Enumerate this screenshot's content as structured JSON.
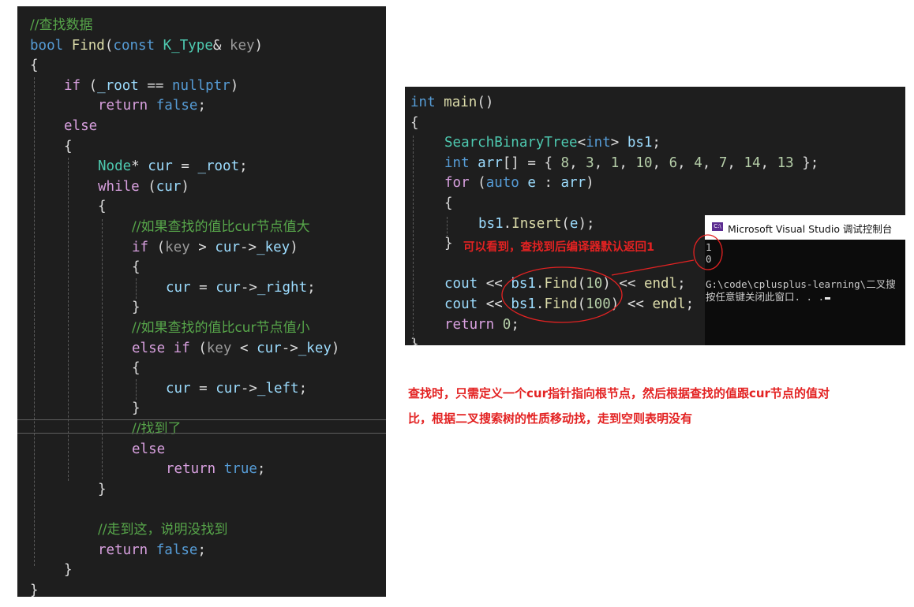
{
  "left_editor": {
    "lines": [
      {
        "indent": 0,
        "tokens": [
          [
            "cm",
            "//查找数据"
          ]
        ]
      },
      {
        "indent": 0,
        "tokens": [
          [
            "kw",
            "bool"
          ],
          [
            "pn",
            " "
          ],
          [
            "fn",
            "Find"
          ],
          [
            "pn",
            "("
          ],
          [
            "kw",
            "const"
          ],
          [
            "pn",
            " "
          ],
          [
            "ty",
            "K_Type"
          ],
          [
            "pn",
            "& "
          ],
          [
            "prm",
            "key"
          ],
          [
            "pn",
            ")"
          ]
        ]
      },
      {
        "indent": 0,
        "tokens": [
          [
            "pn",
            "{"
          ]
        ]
      },
      {
        "indent": 1,
        "tokens": [
          [
            "ctl",
            "if"
          ],
          [
            "pn",
            " ("
          ],
          [
            "var",
            "_root"
          ],
          [
            "pn",
            " == "
          ],
          [
            "kw",
            "nullptr"
          ],
          [
            "pn",
            ")"
          ]
        ]
      },
      {
        "indent": 2,
        "tokens": [
          [
            "ctl",
            "return"
          ],
          [
            "pn",
            " "
          ],
          [
            "kw",
            "false"
          ],
          [
            "pn",
            ";"
          ]
        ]
      },
      {
        "indent": 1,
        "tokens": [
          [
            "ctl",
            "else"
          ]
        ]
      },
      {
        "indent": 1,
        "tokens": [
          [
            "pn",
            "{"
          ]
        ]
      },
      {
        "indent": 2,
        "tokens": [
          [
            "ty",
            "Node"
          ],
          [
            "pn",
            "* "
          ],
          [
            "var",
            "cur"
          ],
          [
            "pn",
            " = "
          ],
          [
            "var",
            "_root"
          ],
          [
            "pn",
            ";"
          ]
        ]
      },
      {
        "indent": 2,
        "tokens": [
          [
            "ctl",
            "while"
          ],
          [
            "pn",
            " ("
          ],
          [
            "var",
            "cur"
          ],
          [
            "pn",
            ")"
          ]
        ]
      },
      {
        "indent": 2,
        "tokens": [
          [
            "pn",
            "{"
          ]
        ]
      },
      {
        "indent": 3,
        "tokens": [
          [
            "cm",
            "//如果查找的值比cur节点值大"
          ]
        ]
      },
      {
        "indent": 3,
        "tokens": [
          [
            "ctl",
            "if"
          ],
          [
            "pn",
            " ("
          ],
          [
            "prm",
            "key"
          ],
          [
            "pn",
            " > "
          ],
          [
            "var",
            "cur"
          ],
          [
            "pn",
            "->"
          ],
          [
            "var",
            "_key"
          ],
          [
            "pn",
            ")"
          ]
        ]
      },
      {
        "indent": 3,
        "tokens": [
          [
            "pn",
            "{"
          ]
        ]
      },
      {
        "indent": 4,
        "tokens": [
          [
            "var",
            "cur"
          ],
          [
            "pn",
            " = "
          ],
          [
            "var",
            "cur"
          ],
          [
            "pn",
            "->"
          ],
          [
            "var",
            "_right"
          ],
          [
            "pn",
            ";"
          ]
        ]
      },
      {
        "indent": 3,
        "tokens": [
          [
            "pn",
            "}"
          ]
        ]
      },
      {
        "indent": 3,
        "tokens": [
          [
            "cm",
            "//如果查找的值比cur节点值小"
          ]
        ]
      },
      {
        "indent": 3,
        "tokens": [
          [
            "ctl",
            "else"
          ],
          [
            "pn",
            " "
          ],
          [
            "ctl",
            "if"
          ],
          [
            "pn",
            " ("
          ],
          [
            "prm",
            "key"
          ],
          [
            "pn",
            " < "
          ],
          [
            "var",
            "cur"
          ],
          [
            "pn",
            "->"
          ],
          [
            "var",
            "_key"
          ],
          [
            "pn",
            ")"
          ]
        ]
      },
      {
        "indent": 3,
        "tokens": [
          [
            "pn",
            "{"
          ]
        ]
      },
      {
        "indent": 4,
        "tokens": [
          [
            "var",
            "cur"
          ],
          [
            "pn",
            " = "
          ],
          [
            "var",
            "cur"
          ],
          [
            "pn",
            "->"
          ],
          [
            "var",
            "_left"
          ],
          [
            "pn",
            ";"
          ]
        ]
      },
      {
        "indent": 3,
        "tokens": [
          [
            "pn",
            "}"
          ]
        ]
      },
      {
        "indent": 3,
        "tokens": [
          [
            "cm",
            "//找到了"
          ]
        ]
      },
      {
        "indent": 3,
        "tokens": [
          [
            "ctl",
            "else"
          ]
        ]
      },
      {
        "indent": 4,
        "tokens": [
          [
            "ctl",
            "return"
          ],
          [
            "pn",
            " "
          ],
          [
            "kw",
            "true"
          ],
          [
            "pn",
            ";"
          ]
        ]
      },
      {
        "indent": 2,
        "tokens": [
          [
            "pn",
            "}"
          ]
        ]
      },
      {
        "indent": 0,
        "tokens": []
      },
      {
        "indent": 2,
        "tokens": [
          [
            "cm",
            "//走到这，说明没找到"
          ]
        ]
      },
      {
        "indent": 2,
        "tokens": [
          [
            "ctl",
            "return"
          ],
          [
            "pn",
            " "
          ],
          [
            "kw",
            "false"
          ],
          [
            "pn",
            ";"
          ]
        ]
      },
      {
        "indent": 1,
        "tokens": [
          [
            "pn",
            "}"
          ]
        ]
      },
      {
        "indent": 0,
        "tokens": [
          [
            "pn",
            "}"
          ]
        ]
      }
    ]
  },
  "right_editor": {
    "lines": [
      {
        "indent": 0,
        "tokens": [
          [
            "kw",
            "int"
          ],
          [
            "pn",
            " "
          ],
          [
            "fn",
            "main"
          ],
          [
            "pn",
            "()"
          ]
        ]
      },
      {
        "indent": 0,
        "tokens": [
          [
            "pn",
            "{"
          ]
        ]
      },
      {
        "indent": 1,
        "tokens": [
          [
            "ty",
            "SearchBinaryTree"
          ],
          [
            "pn",
            "<"
          ],
          [
            "kw",
            "int"
          ],
          [
            "pn",
            "> "
          ],
          [
            "var",
            "bs1"
          ],
          [
            "pn",
            ";"
          ]
        ]
      },
      {
        "indent": 1,
        "tokens": [
          [
            "kw",
            "int"
          ],
          [
            "pn",
            " "
          ],
          [
            "var",
            "arr"
          ],
          [
            "pn",
            "[] = { "
          ],
          [
            "num",
            "8"
          ],
          [
            "pn",
            ", "
          ],
          [
            "num",
            "3"
          ],
          [
            "pn",
            ", "
          ],
          [
            "num",
            "1"
          ],
          [
            "pn",
            ", "
          ],
          [
            "num",
            "10"
          ],
          [
            "pn",
            ", "
          ],
          [
            "num",
            "6"
          ],
          [
            "pn",
            ", "
          ],
          [
            "num",
            "4"
          ],
          [
            "pn",
            ", "
          ],
          [
            "num",
            "7"
          ],
          [
            "pn",
            ", "
          ],
          [
            "num",
            "14"
          ],
          [
            "pn",
            ", "
          ],
          [
            "num",
            "13"
          ],
          [
            "pn",
            " };"
          ]
        ]
      },
      {
        "indent": 1,
        "tokens": [
          [
            "ctl",
            "for"
          ],
          [
            "pn",
            " ("
          ],
          [
            "kw",
            "auto"
          ],
          [
            "pn",
            " "
          ],
          [
            "var",
            "e"
          ],
          [
            "pn",
            " : "
          ],
          [
            "var",
            "arr"
          ],
          [
            "pn",
            ")"
          ]
        ]
      },
      {
        "indent": 1,
        "tokens": [
          [
            "pn",
            "{"
          ]
        ]
      },
      {
        "indent": 2,
        "tokens": [
          [
            "var",
            "bs1"
          ],
          [
            "pn",
            "."
          ],
          [
            "fn",
            "Insert"
          ],
          [
            "pn",
            "("
          ],
          [
            "var",
            "e"
          ],
          [
            "pn",
            ");"
          ]
        ]
      },
      {
        "indent": 1,
        "tokens": [
          [
            "pn",
            "}"
          ]
        ]
      },
      {
        "indent": 0,
        "tokens": []
      },
      {
        "indent": 1,
        "tokens": [
          [
            "var",
            "cout"
          ],
          [
            "pn",
            " << "
          ],
          [
            "var",
            "bs1"
          ],
          [
            "pn",
            "."
          ],
          [
            "fn",
            "Find"
          ],
          [
            "pn",
            "("
          ],
          [
            "num",
            "10"
          ],
          [
            "pn",
            ") << "
          ],
          [
            "fn",
            "endl"
          ],
          [
            "pn",
            ";"
          ]
        ]
      },
      {
        "indent": 1,
        "tokens": [
          [
            "var",
            "cout"
          ],
          [
            "pn",
            " << "
          ],
          [
            "var",
            "bs1"
          ],
          [
            "pn",
            "."
          ],
          [
            "fn",
            "Find"
          ],
          [
            "pn",
            "("
          ],
          [
            "num",
            "100"
          ],
          [
            "pn",
            ") << "
          ],
          [
            "fn",
            "endl"
          ],
          [
            "pn",
            ";"
          ]
        ]
      },
      {
        "indent": 1,
        "tokens": [
          [
            "ctl",
            "return"
          ],
          [
            "pn",
            " "
          ],
          [
            "num",
            "0"
          ],
          [
            "pn",
            ";"
          ]
        ]
      },
      {
        "indent": 0,
        "tokens": [
          [
            "pn",
            "}"
          ]
        ]
      }
    ]
  },
  "console": {
    "title": "Microsoft Visual Studio 调试控制台",
    "icon": "vs-console-icon",
    "output_lines": [
      "1",
      "0",
      "",
      "G:\\code\\cplusplus-learning\\二叉搜",
      "按任意键关闭此窗口. . ."
    ]
  },
  "annotations": {
    "return_note": "可以看到，查找到后编译器默认返回1",
    "description_line1": "查找时，只需定义一个cur指针指向根节点，然后根据查找的值跟cur节点的值对",
    "description_line2": "比，根据二叉搜索树的性质移动找，走到空则表明没有",
    "accent_color": "#e32222"
  }
}
